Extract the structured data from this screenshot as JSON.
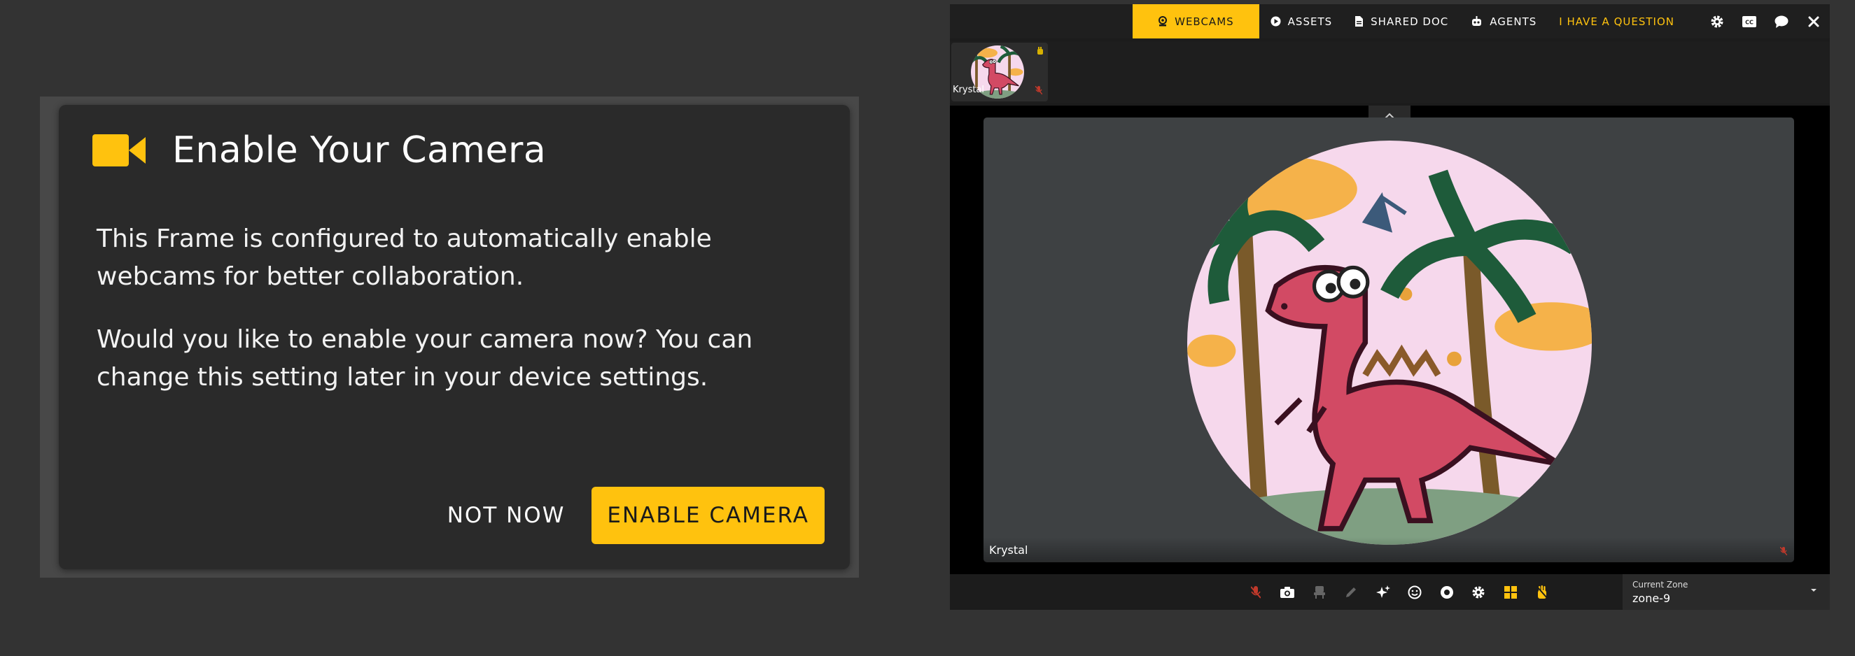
{
  "dialog": {
    "title": "Enable Your Camera",
    "paragraph1": "This Frame is configured to automatically enable webcams for better collaboration.",
    "paragraph2": "Would you like to enable your camera now? You can change this setting later in your device settings.",
    "not_now_label": "NOT NOW",
    "enable_label": "ENABLE CAMERA",
    "icon": "video-camera-icon",
    "accent_color": "#ffc20e"
  },
  "topbar": {
    "tabs": [
      {
        "label": "WEBCAMS",
        "icon": "webcam-icon",
        "active": true
      },
      {
        "label": "ASSETS",
        "icon": "play-circle-icon"
      },
      {
        "label": "SHARED DOC",
        "icon": "document-icon"
      },
      {
        "label": "AGENTS",
        "icon": "robot-icon"
      }
    ],
    "question_label": "I HAVE A QUESTION",
    "tools": [
      "gear-icon",
      "closed-captions-icon",
      "chat-icon",
      "close-icon"
    ],
    "cc_label": "CC",
    "active_color": "#ffc20e"
  },
  "thumbnails": [
    {
      "name": "Krystal",
      "muted": true,
      "hand_icon": "raise-hand-icon"
    }
  ],
  "main_video": {
    "name": "Krystal",
    "muted": true
  },
  "controls": [
    "mic-muted-icon",
    "camera-icon",
    "seat-icon",
    "pencil-icon",
    "sparkle-icon",
    "emoji-icon",
    "record-icon",
    "gear-icon",
    "grid-icon",
    "raise-hand-icon"
  ],
  "zone": {
    "label": "Current Zone",
    "value": "zone-9"
  }
}
